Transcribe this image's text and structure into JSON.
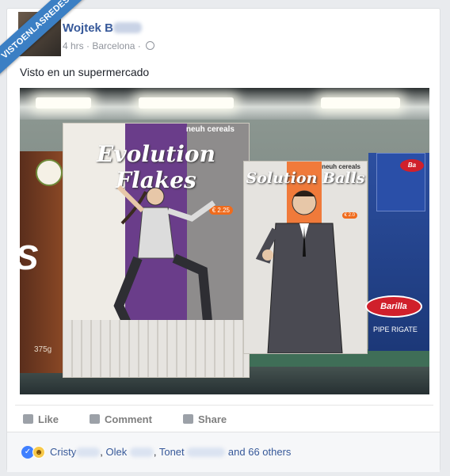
{
  "watermark": "VISTOENLASREDES",
  "post": {
    "author": "Wojtek B",
    "time": "4 hrs",
    "separator": "·",
    "location": "Barcelona",
    "text": "Visto en un supermercado"
  },
  "photo": {
    "box1": {
      "brand": "neuh cereals",
      "title": "Evolution Flakes",
      "price": "€ 2.25"
    },
    "box2": {
      "brand": "neuh cereals",
      "title": "Solution Balls",
      "price": "€ 2.0"
    },
    "left_box": {
      "big": "S",
      "weight": "375g"
    },
    "barilla": {
      "logo": "Barilla",
      "top_logo": "Ba",
      "label": "PIPE RIGATE"
    }
  },
  "actions": {
    "like": "Like",
    "comment": "Comment",
    "share": "Share"
  },
  "reactions": {
    "names": [
      "Cristy",
      "Olek",
      "Tonet"
    ],
    "comma": ",",
    "others": "and 66 others"
  },
  "colors": {
    "link": "#365899",
    "ribbon": "#3b7fc4",
    "like": "#4080ff"
  }
}
